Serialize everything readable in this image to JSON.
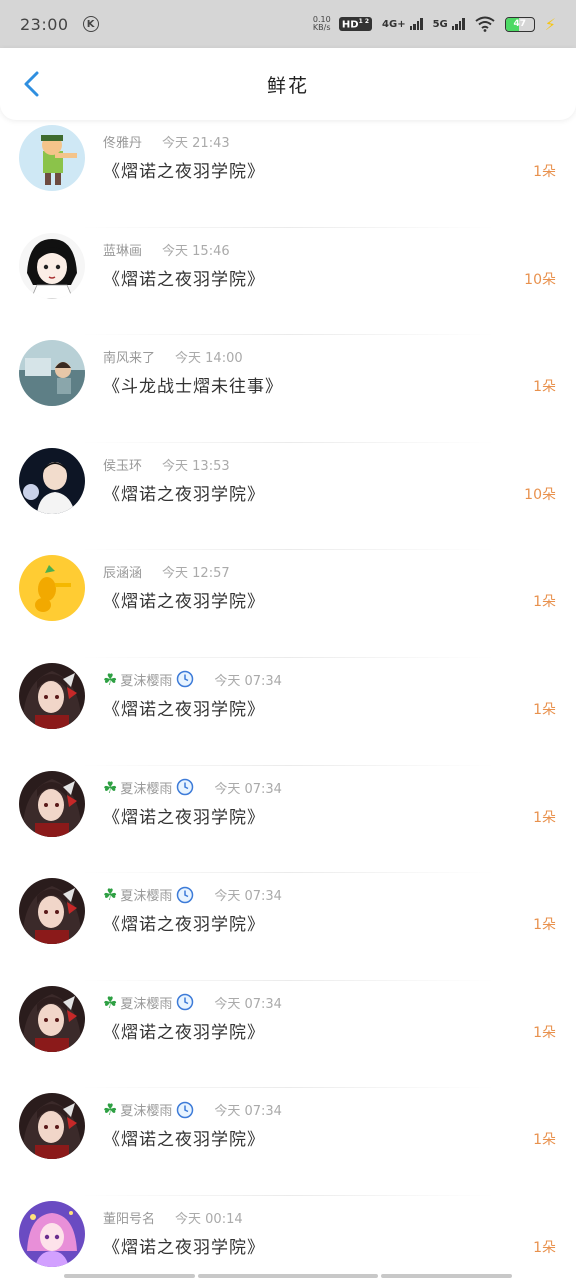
{
  "status_bar": {
    "time": "23:00",
    "k_badge": "K",
    "net_speed_value": "0.10",
    "net_speed_unit": "KB/s",
    "hd": "HD",
    "hd_sub": "1 2",
    "net_4g": "4G+",
    "net_5g": "5G",
    "battery_level": "47"
  },
  "header": {
    "title": "鲜花"
  },
  "items": [
    {
      "name": "佟雅丹",
      "time": "今天 21:43",
      "book": "《熠诺之夜羽学院》",
      "count": "1朵",
      "avatar": "avatar-1"
    },
    {
      "name": "蓝琳画",
      "time": "今天 15:46",
      "book": "《熠诺之夜羽学院》",
      "count": "10朵",
      "avatar": "avatar-2"
    },
    {
      "name": "南风来了",
      "time": "今天 14:00",
      "book": "《斗龙战士熠未往事》",
      "count": "1朵",
      "avatar": "avatar-3"
    },
    {
      "name": "侯玉环",
      "time": "今天 13:53",
      "book": "《熠诺之夜羽学院》",
      "count": "10朵",
      "avatar": "avatar-4"
    },
    {
      "name": "辰涵涵",
      "time": "今天 12:57",
      "book": "《熠诺之夜羽学院》",
      "count": "1朵",
      "avatar": "avatar-5"
    },
    {
      "name": "夏沫樱雨",
      "time": "今天 07:34",
      "book": "《熠诺之夜羽学院》",
      "count": "1朵",
      "avatar": "avatar-6",
      "clover": "☘",
      "clock": true
    },
    {
      "name": "夏沫樱雨",
      "time": "今天 07:34",
      "book": "《熠诺之夜羽学院》",
      "count": "1朵",
      "avatar": "avatar-6",
      "clover": "☘",
      "clock": true
    },
    {
      "name": "夏沫樱雨",
      "time": "今天 07:34",
      "book": "《熠诺之夜羽学院》",
      "count": "1朵",
      "avatar": "avatar-6",
      "clover": "☘",
      "clock": true
    },
    {
      "name": "夏沫樱雨",
      "time": "今天 07:34",
      "book": "《熠诺之夜羽学院》",
      "count": "1朵",
      "avatar": "avatar-6",
      "clover": "☘",
      "clock": true
    },
    {
      "name": "夏沫樱雨",
      "time": "今天 07:34",
      "book": "《熠诺之夜羽学院》",
      "count": "1朵",
      "avatar": "avatar-6",
      "clover": "☘",
      "clock": true
    },
    {
      "name": "董阳号名",
      "time": "今天 00:14",
      "book": "《熠诺之夜羽学院》",
      "count": "1朵",
      "avatar": "avatar-7"
    }
  ],
  "colors": {
    "accent": "#2f8fe0",
    "count": "#e8914d",
    "status_bar_bg": "#d6d6d6",
    "battery_green": "#4cd964"
  }
}
